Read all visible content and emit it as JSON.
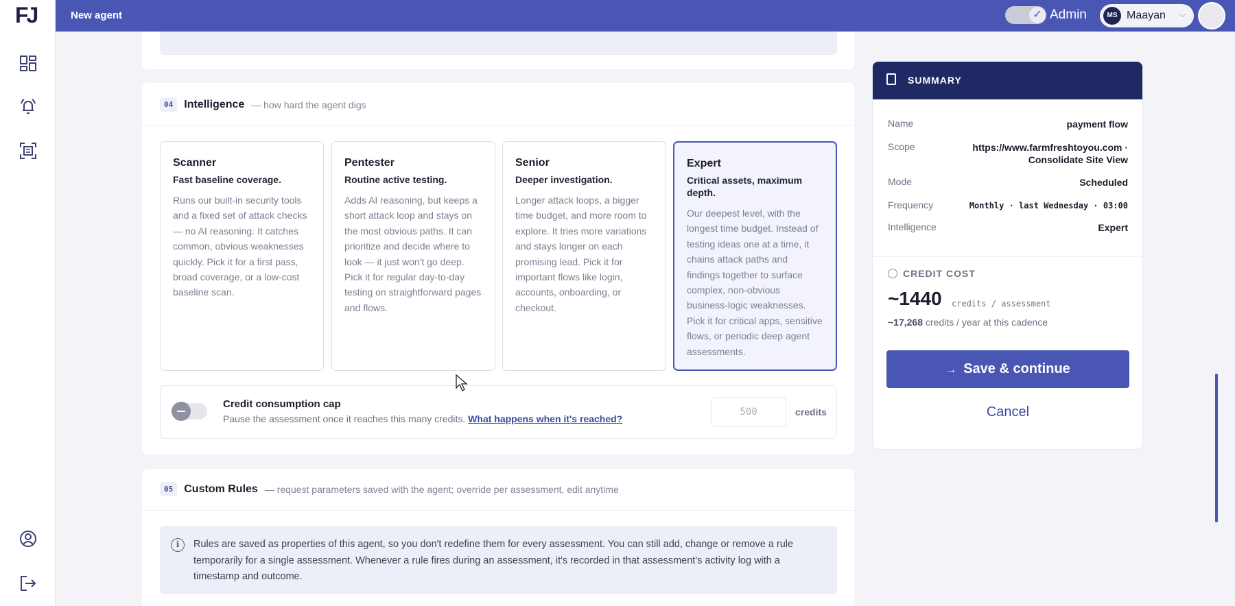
{
  "header": {
    "title": "New agent",
    "admin_label": "Admin",
    "user_initials": "MS",
    "user_name": "Maayan"
  },
  "sidebar": {
    "icons": [
      "dashboard-icon",
      "alert-bell-icon",
      "scan-icon",
      "account-icon",
      "logout-icon"
    ]
  },
  "intelligence": {
    "number": "04",
    "title": "Intelligence",
    "subtitle": "— how hard the agent digs",
    "levels": [
      {
        "name": "Scanner",
        "tagline": "Fast baseline coverage.",
        "description": "Runs our built-in security tools and a fixed set of attack checks — no AI reasoning. It catches common, obvious weaknesses quickly. Pick it for a first pass, broad coverage, or a low-cost baseline scan.",
        "selected": false
      },
      {
        "name": "Pentester",
        "tagline": "Routine active testing.",
        "description": "Adds AI reasoning, but keeps a short attack loop and stays on the most obvious paths. It can prioritize and decide where to look — it just won't go deep. Pick it for regular day-to-day testing on straightforward pages and flows.",
        "selected": false
      },
      {
        "name": "Senior",
        "tagline": "Deeper investigation.",
        "description": "Longer attack loops, a bigger time budget, and more room to explore. It tries more variations and stays longer on each promising lead. Pick it for important flows like login, accounts, onboarding, or checkout.",
        "selected": false
      },
      {
        "name": "Expert",
        "tagline": "Critical assets, maximum depth.",
        "description": "Our deepest level, with the longest time budget. Instead of testing ideas one at a time, it chains attack paths and findings together to surface complex, non-obvious business-logic weaknesses. Pick it for critical apps, sensitive flows, or periodic deep agent assessments.",
        "selected": true
      }
    ],
    "credit_cap": {
      "title": "Credit consumption cap",
      "description": "Pause the assessment once it reaches this many credits.",
      "link": "What happens when it's reached?",
      "placeholder": "500",
      "unit": "credits",
      "enabled": false
    }
  },
  "custom_rules": {
    "number": "05",
    "title": "Custom Rules",
    "subtitle": "— request parameters saved with the agent; override per assessment, edit anytime",
    "info": "Rules are saved as properties of this agent, so you don't redefine them for every assessment. You can still add, change or remove a rule temporarily for a single assessment. Whenever a rule fires during an assessment, it's recorded in that assessment's activity log with a timestamp and outcome."
  },
  "summary": {
    "heading": "SUMMARY",
    "rows": [
      {
        "key": "Name",
        "value": "payment flow"
      },
      {
        "key": "Scope",
        "value": "https://www.farmfreshtoyou.com · Consolidate Site View"
      },
      {
        "key": "Mode",
        "value": "Scheduled"
      },
      {
        "key": "Frequency",
        "value": "Monthly · last Wednesday · 03:00"
      },
      {
        "key": "Intelligence",
        "value": "Expert"
      }
    ],
    "credit_cost_label": "CREDIT COST",
    "credits_value": "~1440",
    "credits_unit": "credits / assessment",
    "yearly_value": "~17,268",
    "yearly_suffix": "credits / year at this cadence",
    "save_label": "Save & continue",
    "cancel_label": "Cancel"
  },
  "colors": {
    "brand": "#4a56b4",
    "navy": "#1f2a64",
    "selected_bg": "#f2f3fd"
  }
}
